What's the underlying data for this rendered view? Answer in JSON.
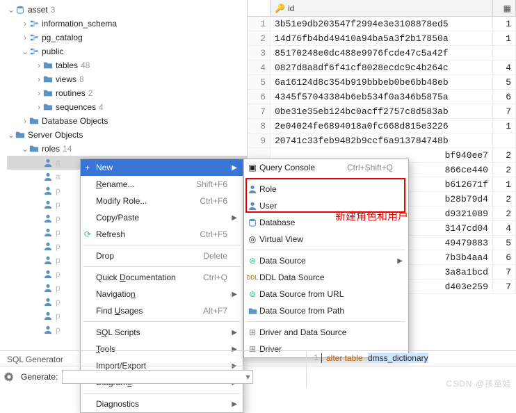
{
  "tree": {
    "asset": {
      "label": "asset",
      "count": "3"
    },
    "info_schema": "information_schema",
    "pg_catalog": "pg_catalog",
    "public": "public",
    "tables": {
      "label": "tables",
      "count": "48"
    },
    "views": {
      "label": "views",
      "count": "8"
    },
    "routines": {
      "label": "routines",
      "count": "2"
    },
    "sequences": {
      "label": "sequences",
      "count": "4"
    },
    "db_objects": "Database Objects",
    "server_objects": "Server Objects",
    "roles": {
      "label": "roles",
      "count": "14"
    },
    "role_letters": [
      "a",
      "a",
      "p",
      "p",
      "p",
      "p",
      "p",
      "p",
      "p",
      "p",
      "p",
      "p",
      "p"
    ]
  },
  "table": {
    "id_header": "id",
    "rows": [
      {
        "n": "1",
        "id": "3b51e9db203547f2994e3e3108878ed5",
        "v": "1"
      },
      {
        "n": "2",
        "id": "14d76fb4bd49410a94ba5a3f2b17850a",
        "v": "1"
      },
      {
        "n": "3",
        "id": "85170248e0dc488e9976fcde47c5a42f",
        "v": ""
      },
      {
        "n": "4",
        "id": "0827d8a8df6f41cf8028ecdc9c4b264c",
        "v": "4"
      },
      {
        "n": "5",
        "id": "6a16124d8c354b919bbbeb0be6bb48eb",
        "v": "5"
      },
      {
        "n": "6",
        "id": "4345f57043384b6eb534f0a346b5875a",
        "v": "6"
      },
      {
        "n": "7",
        "id": "0be31e35eb124bc0acff2757c8d583ab",
        "v": "7"
      },
      {
        "n": "8",
        "id": "2e04024fe6894018a0fc668d815e3226",
        "v": "1"
      },
      {
        "n": "9",
        "id": "20741c33feb9482b9ccf6a913784748b",
        "v": ""
      }
    ],
    "cutrows": [
      {
        "id": "bf940ee7",
        "v": "2"
      },
      {
        "id": "866ce440",
        "v": "2"
      },
      {
        "id": "b612671f",
        "v": "1"
      },
      {
        "id": "b28b79d4",
        "v": "2"
      },
      {
        "id": "d9321089",
        "v": "2"
      },
      {
        "id": "3147cd04",
        "v": "4"
      },
      {
        "id": "49479883",
        "v": "5"
      },
      {
        "id": "7b3b4aa4",
        "v": "6"
      },
      {
        "id": "3a8a1bcd",
        "v": "7"
      },
      {
        "id": "d403e259",
        "v": "7"
      }
    ]
  },
  "menu1": {
    "new": "New",
    "rename": "Rename...",
    "rename_sc": "Shift+F6",
    "modify": "Modify Role...",
    "modify_sc": "Ctrl+F6",
    "copypaste": "Copy/Paste",
    "refresh": "Refresh",
    "refresh_sc": "Ctrl+F5",
    "drop": "Drop",
    "drop_sc": "Delete",
    "quickdoc": "Quick Documentation",
    "quickdoc_sc": "Ctrl+Q",
    "nav": "Navigation",
    "findusages": "Find Usages",
    "findusages_sc": "Alt+F7",
    "sqlscripts": "SQL Scripts",
    "tools": "Tools",
    "impexp": "Import/Export",
    "diagrams": "Diagrams",
    "diagnostics": "Diagnostics"
  },
  "menu2": {
    "qc": "Query Console",
    "qc_sc": "Ctrl+Shift+Q",
    "role": "Role",
    "user": "User",
    "db": "Database",
    "vv": "Virtual View",
    "ds": "Data Source",
    "ddl": "DDL Data Source",
    "dsurl": "Data Source from URL",
    "dspath": "Data Source from Path",
    "drvds": "Driver and Data Source",
    "drv": "Driver"
  },
  "annotation": "新建角色和用户",
  "bottom": {
    "sql_gen": "SQL Generator",
    "generate": "Generate:",
    "sql1a": "alter table",
    "sql1b": "dmss_dictionary"
  },
  "watermark": "CSDN @孩童娃"
}
